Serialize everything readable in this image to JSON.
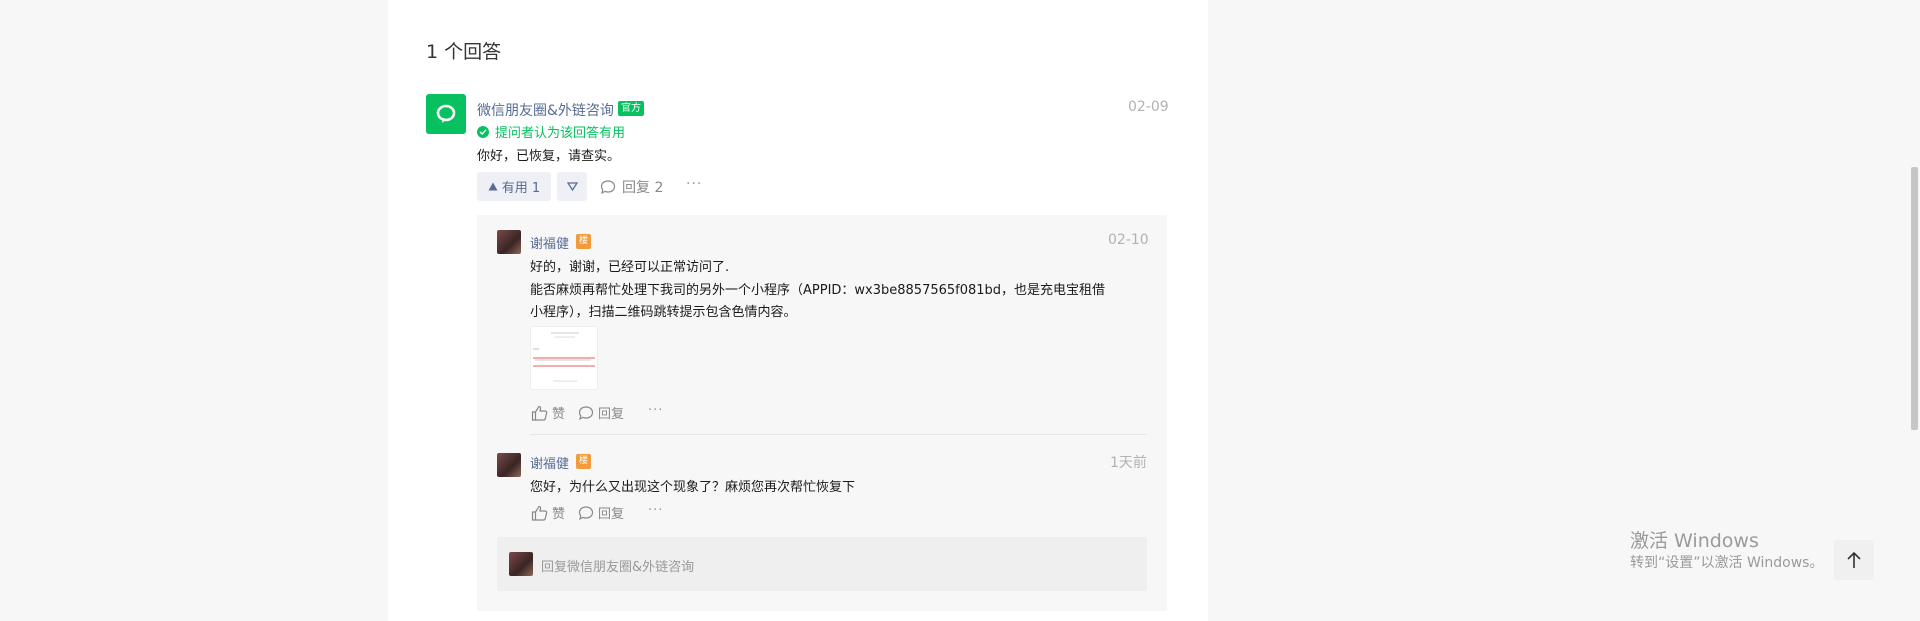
{
  "answers_header": {
    "count_label": "1 个回答"
  },
  "answer": {
    "author": "微信朋友圈&外链咨询",
    "badge": "官方",
    "date": "02-09",
    "useful_note": "提问者认为该回答有用",
    "content": "你好，已恢复，请查实。",
    "actions": {
      "like_label": "有用 1",
      "reply_label": "回复 2",
      "more": "···"
    }
  },
  "replies": [
    {
      "author": "谢福健",
      "badge": "楼",
      "date": "02-10",
      "lines": [
        "好的，谢谢，已经可以正常访问了.",
        "能否麻烦再帮忙处理下我司的另外一个小程序（APPID：wx3be8857565f081bd，也是充电宝租借",
        "小程序），扫描二维码跳转提示包含色情内容。"
      ],
      "actions": {
        "like": "赞",
        "reply": "回复",
        "more": "···"
      }
    },
    {
      "author": "谢福健",
      "badge": "楼",
      "date": "1天前",
      "lines": [
        "您好，为什么又出现这个现象了？麻烦您再次帮忙恢复下"
      ],
      "actions": {
        "like": "赞",
        "reply": "回复",
        "more": "···"
      }
    }
  ],
  "reply_input": {
    "placeholder": "回复微信朋友圈&外链咨询"
  },
  "watermark": {
    "line1": "激活 Windows",
    "line2": "转到“设置”以激活 Windows。"
  },
  "colors": {
    "brand_green": "#07c160",
    "link_blue": "#576b95",
    "badge_orange": "#f29a3c"
  }
}
